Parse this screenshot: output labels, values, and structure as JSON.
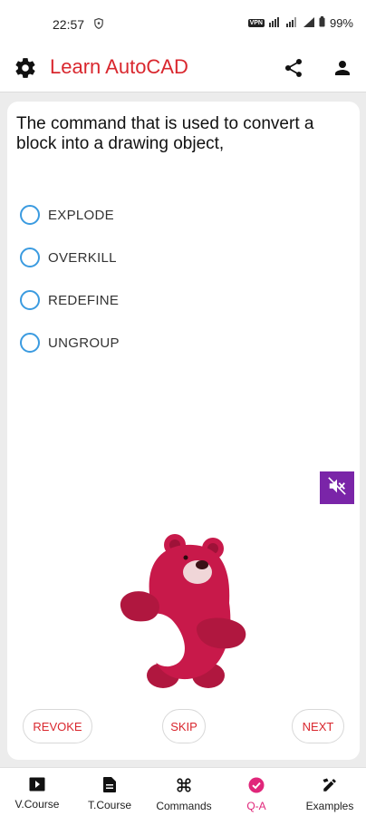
{
  "status_bar": {
    "time": "22:57",
    "battery": "99%",
    "vpn": "VPN"
  },
  "app_bar": {
    "title": "Learn AutoCAD",
    "icons": [
      "gear-icon",
      "share-icon",
      "person-icon"
    ]
  },
  "question": {
    "text": "The command that is used to convert a block into a drawing object,",
    "options": [
      {
        "label": "EXPLODE",
        "selected": false
      },
      {
        "label": "OVERKILL",
        "selected": false
      },
      {
        "label": "REDEFINE",
        "selected": false
      },
      {
        "label": "UNGROUP",
        "selected": false
      }
    ]
  },
  "controls": {
    "revoke": "REVOKE",
    "skip": "SKIP",
    "next": "NEXT",
    "mute_icon": "speaker-muted-icon"
  },
  "bottom_nav": {
    "items": [
      {
        "label": "V.Course",
        "icon": "play-icon"
      },
      {
        "label": "T.Course",
        "icon": "document-icon"
      },
      {
        "label": "Commands",
        "icon": "command-icon"
      },
      {
        "label": "Q-A",
        "icon": "check-circle-icon",
        "active": true
      },
      {
        "label": "Examples",
        "icon": "pencil-ruler-icon"
      }
    ]
  },
  "colors": {
    "brand_red": "#d9272e",
    "radio_blue": "#3b9be0",
    "mute_purple": "#7a25a8",
    "active_tab": "#e0267a"
  }
}
